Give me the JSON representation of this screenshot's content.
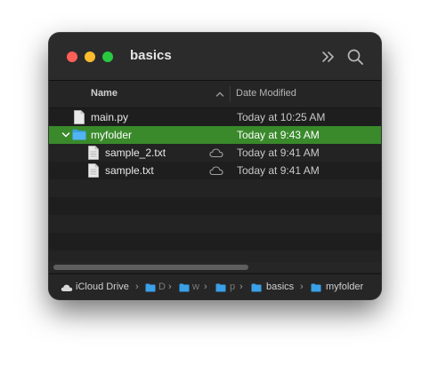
{
  "window": {
    "title": "basics"
  },
  "toolbar": {
    "more_icon": "chevron-double-right-icon",
    "search_icon": "search-icon"
  },
  "columns": {
    "name": "Name",
    "date_modified": "Date Modified"
  },
  "files": [
    {
      "name": "main.py",
      "date": "Today at 10:25 AM",
      "kind": "file",
      "indent": 0,
      "selected": false,
      "cloud": false
    },
    {
      "name": "myfolder",
      "date": "Today at 9:43 AM",
      "kind": "folder",
      "indent": 0,
      "expanded": true,
      "selected": true,
      "cloud": false
    },
    {
      "name": "sample_2.txt",
      "date": "Today at 9:41 AM",
      "kind": "file",
      "indent": 1,
      "selected": false,
      "cloud": true
    },
    {
      "name": "sample.txt",
      "date": "Today at 9:41 AM",
      "kind": "file",
      "indent": 1,
      "selected": false,
      "cloud": true
    }
  ],
  "pathbar": {
    "root": "iCloud Drive",
    "items": [
      "D",
      "w",
      "p",
      "basics",
      "myfolder"
    ]
  },
  "colors": {
    "selection": "#3a8a2c",
    "folder": "#3aa0e8",
    "window_bg": "#1e1e1e"
  }
}
